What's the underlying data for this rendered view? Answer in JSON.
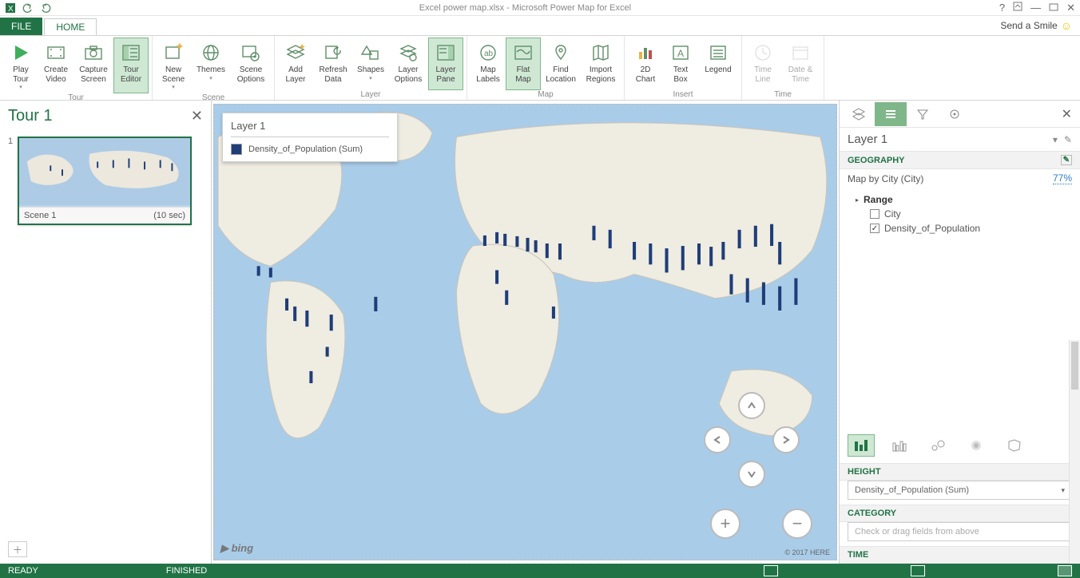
{
  "title": "Excel power map.xlsx - Microsoft Power Map for Excel",
  "tabs": {
    "file": "FILE",
    "home": "HOME"
  },
  "smile": "Send a Smile",
  "ribbon": {
    "groups": {
      "tour": {
        "label": "Tour",
        "play": "Play\nTour",
        "create": "Create\nVideo",
        "capture": "Capture\nScreen",
        "editor": "Tour\nEditor"
      },
      "scene": {
        "label": "Scene",
        "new": "New\nScene",
        "themes": "Themes",
        "options": "Scene\nOptions"
      },
      "layer": {
        "label": "Layer",
        "add": "Add\nLayer",
        "refresh": "Refresh\nData",
        "shapes": "Shapes",
        "loptions": "Layer\nOptions",
        "pane": "Layer\nPane"
      },
      "map": {
        "label": "Map",
        "labels": "Map\nLabels",
        "flat": "Flat\nMap",
        "find": "Find\nLocation",
        "regions": "Import\nRegions"
      },
      "insert": {
        "label": "Insert",
        "chart": "2D\nChart",
        "text": "Text\nBox",
        "legend": "Legend"
      },
      "time": {
        "label": "Time",
        "line": "Time\nLine",
        "dt": "Date &\nTime"
      }
    }
  },
  "left": {
    "tour_name": "Tour 1",
    "scene_num": "1",
    "scene_name": "Scene 1",
    "scene_dur": "(10 sec)"
  },
  "legend": {
    "title": "Layer 1",
    "series": "Density_of_Population (Sum)"
  },
  "map": {
    "brand": "bing",
    "copyright": "© 2017 HERE"
  },
  "right": {
    "layer_name": "Layer 1",
    "geo_hdr": "GEOGRAPHY",
    "geo_row": "Map by City (City)",
    "geo_pct": "77%",
    "range": "Range",
    "city": "City",
    "density": "Density_of_Population",
    "height_hdr": "HEIGHT",
    "height_field": "Density_of_Population (Sum)",
    "category_hdr": "CATEGORY",
    "category_hint": "Check or drag fields from above",
    "time_hdr": "TIME"
  },
  "status": {
    "ready": "READY",
    "finished": "FINISHED"
  }
}
